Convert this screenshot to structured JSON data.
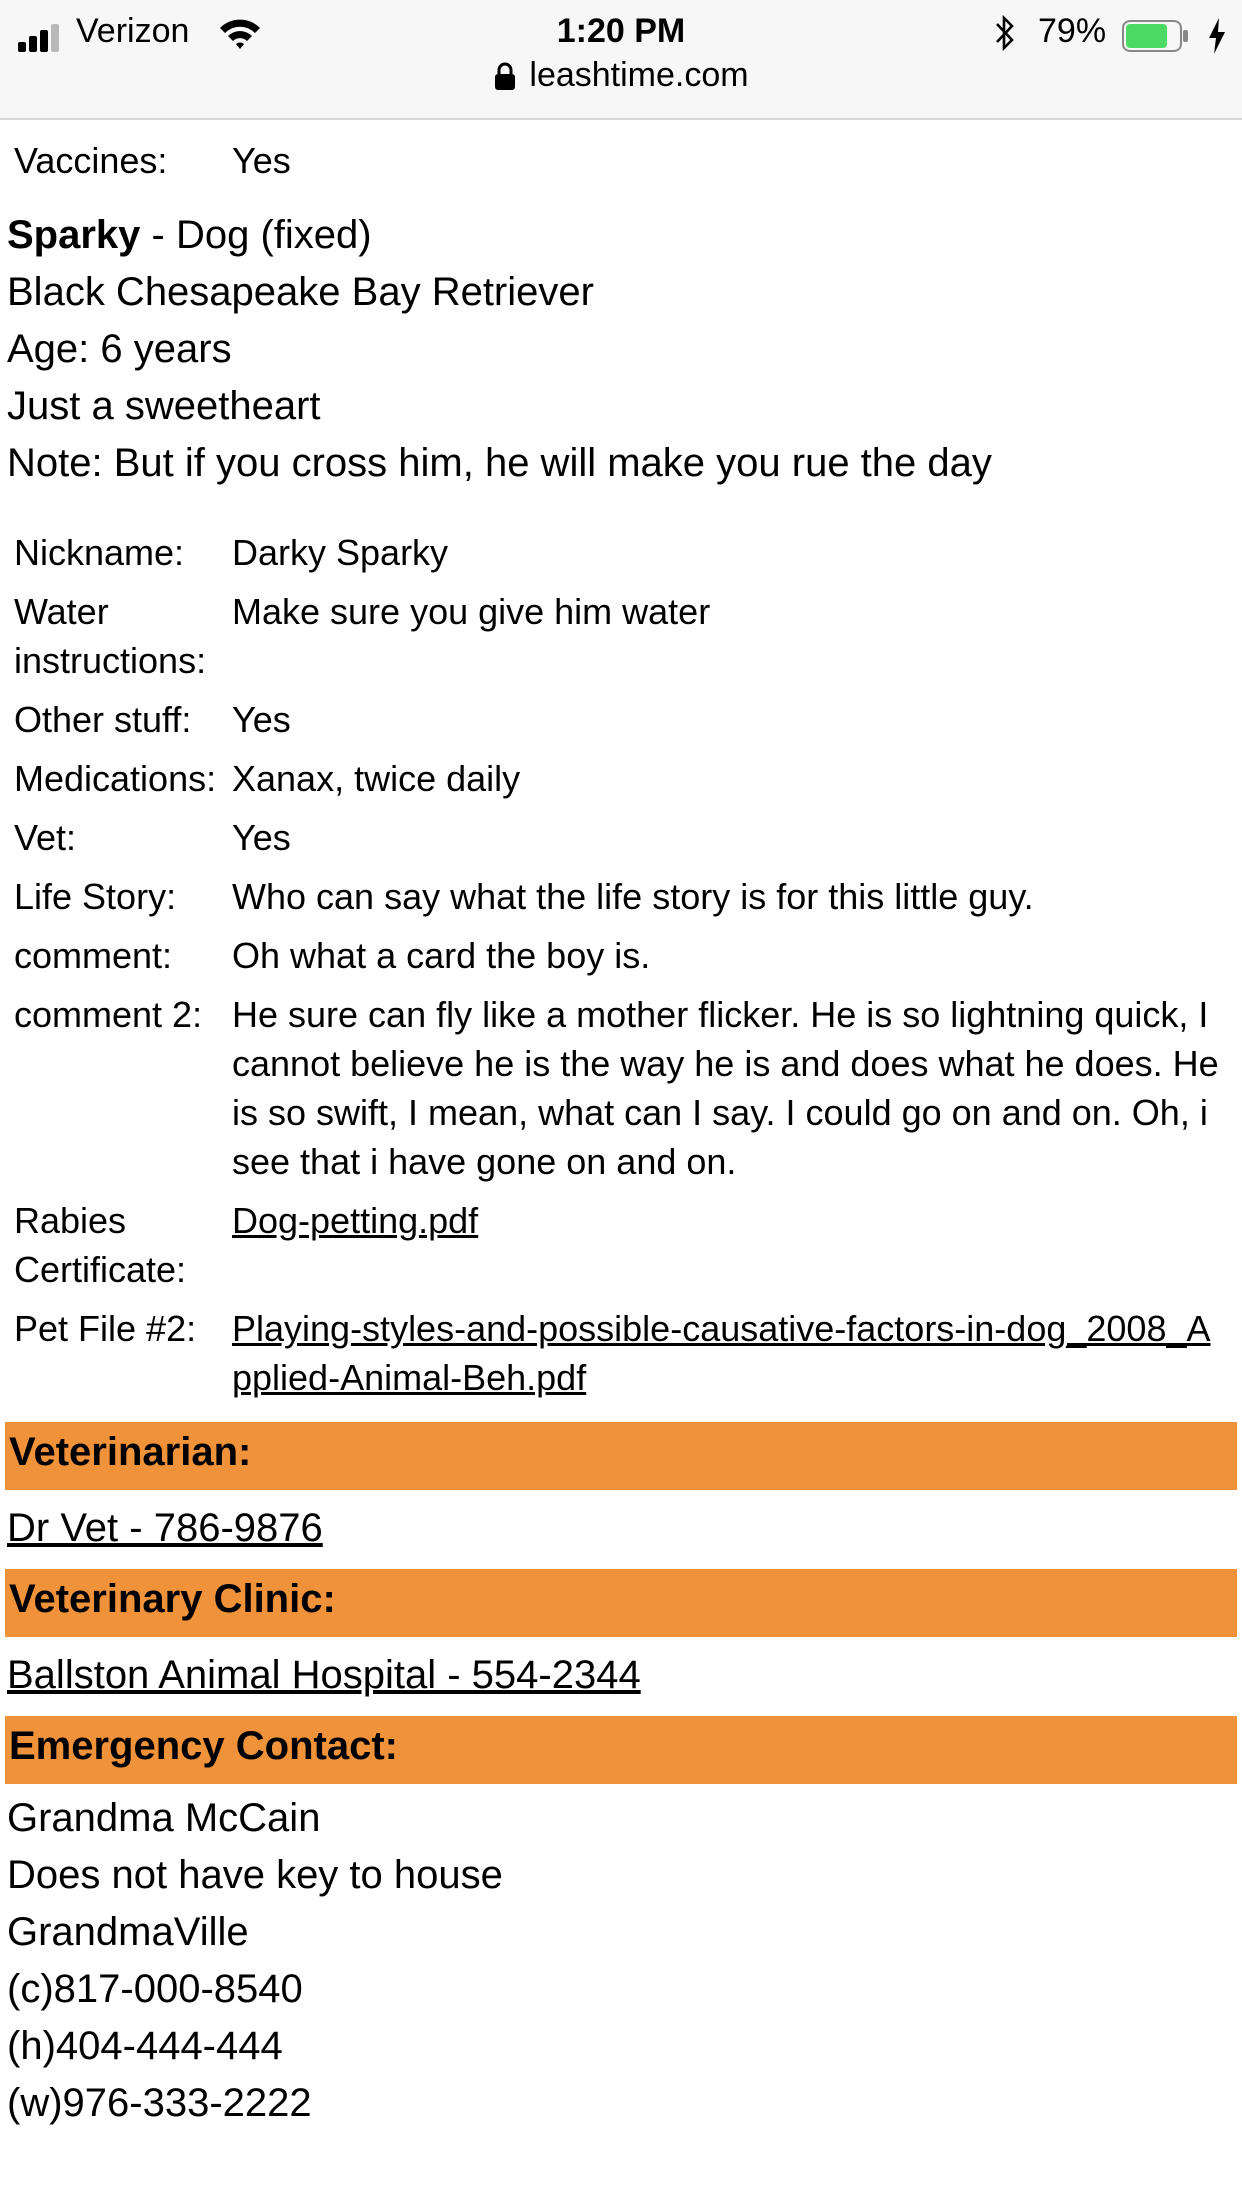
{
  "status_bar": {
    "carrier": "Verizon",
    "time": "1:20 PM",
    "battery_percent": "79%",
    "battery_level": 0.79,
    "url": "leashtime.com"
  },
  "vaccines": {
    "label": "Vaccines:",
    "value": "Yes"
  },
  "pet": {
    "name": "Sparky",
    "type": " - Dog (fixed)",
    "breed": "Black Chesapeake Bay Retriever",
    "age": "Age: 6 years",
    "description": "Just a sweetheart",
    "note": "Note: But if you cross him, he will make you rue the day"
  },
  "details": [
    {
      "label": "Nickname:",
      "value": "Darky Sparky"
    },
    {
      "label": "Water instructions:",
      "value": "Make sure you give him water"
    },
    {
      "label": "Other stuff:",
      "value": "Yes"
    },
    {
      "label": "Medications:",
      "value": "Xanax, twice daily"
    },
    {
      "label": "Vet:",
      "value": "Yes"
    },
    {
      "label": "Life Story:",
      "value": "Who can say what the life story is for this little guy."
    },
    {
      "label": "comment:",
      "value": "Oh what a card the boy is."
    },
    {
      "label": "comment 2:",
      "value": "He sure can fly like a mother flicker. He is so lightning quick, I cannot believe he is the way he is and does what he does. He is so swift, I mean, what can I say. I could go on and on. Oh, i see that i have gone on and on."
    },
    {
      "label": "Rabies Certificate:",
      "value": "Dog-petting.pdf"
    },
    {
      "label": "Pet File #2:",
      "value": "Playing-styles-and-possible-causative-factors-in-dog_2008_Applied-Animal-Beh.pdf"
    }
  ],
  "veterinarian": {
    "heading": "Veterinarian:",
    "link": "Dr Vet - 786-9876"
  },
  "clinic": {
    "heading": "Veterinary Clinic:",
    "link": "Ballston Animal Hospital - 554-2344"
  },
  "emergency": {
    "heading": "Emergency Contact:",
    "lines": [
      "Grandma McCain",
      "Does not have key to house",
      "GrandmaVille",
      "(c)817-000-8540",
      "(h)404-444-444",
      "(w)976-333-2222"
    ]
  },
  "colors": {
    "section_bar": "#f0923a",
    "battery_fill": "#4cd964"
  },
  "icons": [
    "signal-icon",
    "wifi-icon",
    "bluetooth-icon",
    "battery-icon",
    "charging-bolt-icon",
    "lock-icon"
  ]
}
